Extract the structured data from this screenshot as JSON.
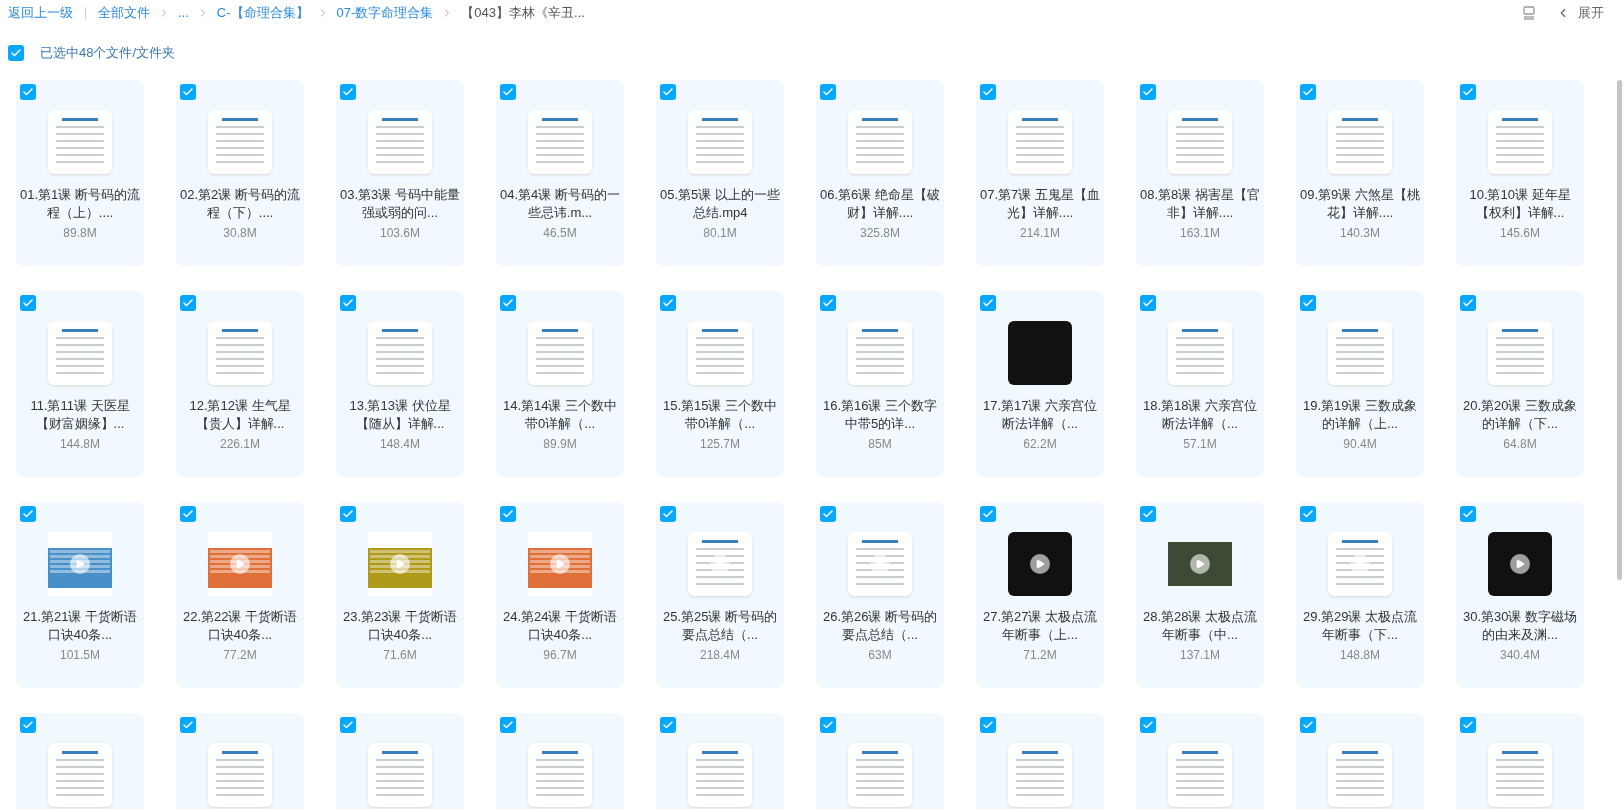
{
  "toolbar": {
    "back": "返回上一级",
    "breadcrumbs": [
      {
        "label": "全部文件",
        "selected": false
      },
      {
        "label": "...",
        "selected": false
      },
      {
        "label": "C-【命理合集】",
        "selected": false
      },
      {
        "label": "07-数字命理合集",
        "selected": false
      },
      {
        "label": "【043】李林《辛丑...",
        "selected": true
      }
    ],
    "expand": "展开"
  },
  "selection": {
    "checked": true,
    "label": "已选中48个文件/文件夹"
  },
  "files": [
    {
      "name": "01.第1课 断号码的流程（上）....",
      "size": "89.8M",
      "checked": true,
      "kind": "doc",
      "video": false
    },
    {
      "name": "02.第2课 断号码的流程（下）....",
      "size": "30.8M",
      "checked": true,
      "kind": "doc",
      "video": false
    },
    {
      "name": "03.第3课 号码中能量强或弱的问...",
      "size": "103.6M",
      "checked": true,
      "kind": "doc",
      "video": false
    },
    {
      "name": "04.第4课 断号码的一些忌讳.m...",
      "size": "46.5M",
      "checked": true,
      "kind": "doc",
      "video": false
    },
    {
      "name": "05.第5课 以上的一些总结.mp4",
      "size": "80.1M",
      "checked": true,
      "kind": "doc",
      "video": false
    },
    {
      "name": "06.第6课 绝命星【破财】详解....",
      "size": "325.8M",
      "checked": true,
      "kind": "doc",
      "video": false
    },
    {
      "name": "07.第7课 五鬼星【血光】详解....",
      "size": "214.1M",
      "checked": true,
      "kind": "doc",
      "video": false
    },
    {
      "name": "08.第8课 祸害星【官非】详解....",
      "size": "163.1M",
      "checked": true,
      "kind": "doc",
      "video": false
    },
    {
      "name": "09.第9课 六煞星【桃花】详解....",
      "size": "140.3M",
      "checked": true,
      "kind": "doc",
      "video": false
    },
    {
      "name": "10.第10课 延年星【权利】详解...",
      "size": "145.6M",
      "checked": true,
      "kind": "doc",
      "video": false
    },
    {
      "name": "11.第11课 天医星【财富姻缘】...",
      "size": "144.8M",
      "checked": true,
      "kind": "doc",
      "video": false
    },
    {
      "name": "12.第12课 生气星【贵人】详解...",
      "size": "226.1M",
      "checked": true,
      "kind": "doc",
      "video": false
    },
    {
      "name": "13.第13课 伏位星【随从】详解...",
      "size": "148.4M",
      "checked": true,
      "kind": "doc",
      "video": false
    },
    {
      "name": "14.第14课 三个数中带0详解（...",
      "size": "89.9M",
      "checked": true,
      "kind": "doc",
      "video": false
    },
    {
      "name": "15.第15课 三个数中带0详解（...",
      "size": "125.7M",
      "checked": true,
      "kind": "doc",
      "video": false
    },
    {
      "name": "16.第16课 三个数字中带5的详...",
      "size": "85M",
      "checked": true,
      "kind": "doc",
      "video": false
    },
    {
      "name": "17.第17课 六亲宫位断法详解（...",
      "size": "62.2M",
      "checked": true,
      "kind": "dark",
      "video": false
    },
    {
      "name": "18.第18课 六亲宫位断法详解（...",
      "size": "57.1M",
      "checked": true,
      "kind": "doc",
      "video": false
    },
    {
      "name": "19.第19课 三数成象的详解（上...",
      "size": "90.4M",
      "checked": true,
      "kind": "doc",
      "video": false
    },
    {
      "name": "20.第20课 三数成象的详解（下...",
      "size": "64.8M",
      "checked": true,
      "kind": "doc",
      "video": false
    },
    {
      "name": "21.第21课 干货断语口诀40条...",
      "size": "101.5M",
      "checked": true,
      "kind": "banner",
      "color": "#4a90c8",
      "video": true
    },
    {
      "name": "22.第22课 干货断语口诀40条...",
      "size": "77.2M",
      "checked": true,
      "kind": "banner",
      "color": "#e0703a",
      "video": true
    },
    {
      "name": "23.第23课 干货断语口诀40条...",
      "size": "71.6M",
      "checked": true,
      "kind": "banner",
      "color": "#b09a1a",
      "video": true
    },
    {
      "name": "24.第24课 干货断语口诀40条...",
      "size": "96.7M",
      "checked": true,
      "kind": "banner",
      "color": "#e0703a",
      "video": true
    },
    {
      "name": "25.第25课 断号码的要点总结（...",
      "size": "218.4M",
      "checked": true,
      "kind": "doc",
      "video": true
    },
    {
      "name": "26.第26课 断号码的要点总结（...",
      "size": "63M",
      "checked": true,
      "kind": "doc",
      "video": true
    },
    {
      "name": "27.第27课 太极点流年断事（上...",
      "size": "71.2M",
      "checked": true,
      "kind": "dark",
      "video": true
    },
    {
      "name": "28.第28课 太极点流年断事（中...",
      "size": "137.1M",
      "checked": true,
      "kind": "photo",
      "video": true
    },
    {
      "name": "29.第29课 太极点流年断事（下...",
      "size": "148.8M",
      "checked": true,
      "kind": "doc",
      "video": true
    },
    {
      "name": "30.第30课 数字磁场的由来及渊...",
      "size": "340.4M",
      "checked": true,
      "kind": "dark",
      "video": true
    },
    {
      "checked": true,
      "kind": "doc",
      "video": false
    },
    {
      "checked": true,
      "kind": "doc",
      "video": false
    },
    {
      "checked": true,
      "kind": "doc",
      "video": false
    },
    {
      "checked": true,
      "kind": "doc",
      "video": false
    },
    {
      "checked": true,
      "kind": "doc",
      "video": false
    },
    {
      "checked": true,
      "kind": "doc",
      "video": false
    },
    {
      "checked": true,
      "kind": "doc",
      "video": false
    },
    {
      "checked": true,
      "kind": "doc",
      "video": false
    },
    {
      "checked": true,
      "kind": "doc",
      "video": false
    },
    {
      "checked": true,
      "kind": "doc",
      "video": false
    }
  ]
}
